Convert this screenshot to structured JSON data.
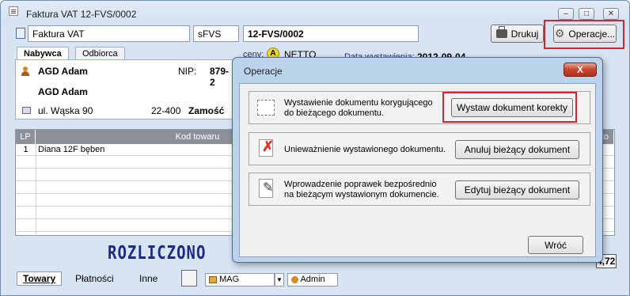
{
  "window": {
    "title": "Faktura VAT 12-FVS/0002"
  },
  "header": {
    "doc_type": "Faktura VAT",
    "series": "sFVS",
    "number": "12-FVS/0002",
    "print_label": "Drukuj",
    "operations_label": "Operacje..."
  },
  "tabs": {
    "buyer": "Nabywca",
    "recipient": "Odbiorca"
  },
  "prices": {
    "label": "ceny:",
    "badge": "A",
    "mode": "NETTO"
  },
  "issue_date": {
    "label": "Data wystawienia:",
    "value": "2012-09-04"
  },
  "buyer": {
    "name": "AGD Adam",
    "name2": "AGD Adam",
    "nip_label": "NIP:",
    "nip_partial": "879-2",
    "street": "ul. Wąska 90",
    "postcode": "22-400",
    "city_partial": "Zamość"
  },
  "table": {
    "headers": {
      "lp": "LP",
      "code": "Kod towaru",
      "right": "etto"
    },
    "rows": [
      {
        "lp": "1",
        "name": "Diana 12F bęben"
      }
    ]
  },
  "status_stamp": "ROZLICZONO",
  "total_partial": "4,72",
  "bottom": {
    "tabs": [
      "Towary",
      "Płatności",
      "Inne"
    ],
    "warehouse": "MAG",
    "user": "Admin"
  },
  "dialog": {
    "title": "Operacje",
    "close_label": "X",
    "options": [
      {
        "text_line1": "Wystawienie dokumentu korygującego",
        "text_line2": "do bieżącego dokumentu.",
        "button": "Wystaw dokument korekty"
      },
      {
        "text_line1": "Unieważnienie wystawionego dokumentu.",
        "text_line2": "",
        "button": "Anuluj bieżący dokument"
      },
      {
        "text_line1": "Wprowadzenie poprawek bezpośrednio",
        "text_line2": "na bieżącym wystawionym dokumencie.",
        "button": "Edytuj bieżący dokument"
      }
    ],
    "back_button": "Wróć"
  },
  "colors": {
    "highlight": "#d9232e",
    "stamp": "#1d2b86",
    "window_bg": "#d8e4f2"
  },
  "icons": [
    "app-icon",
    "document-icon",
    "printer-icon",
    "gear-icon",
    "person-icon",
    "address-card-icon",
    "edit-doc-icon",
    "cancel-doc-icon",
    "pencil-doc-icon",
    "calendar-icon",
    "warehouse-icon",
    "user-icon"
  ]
}
